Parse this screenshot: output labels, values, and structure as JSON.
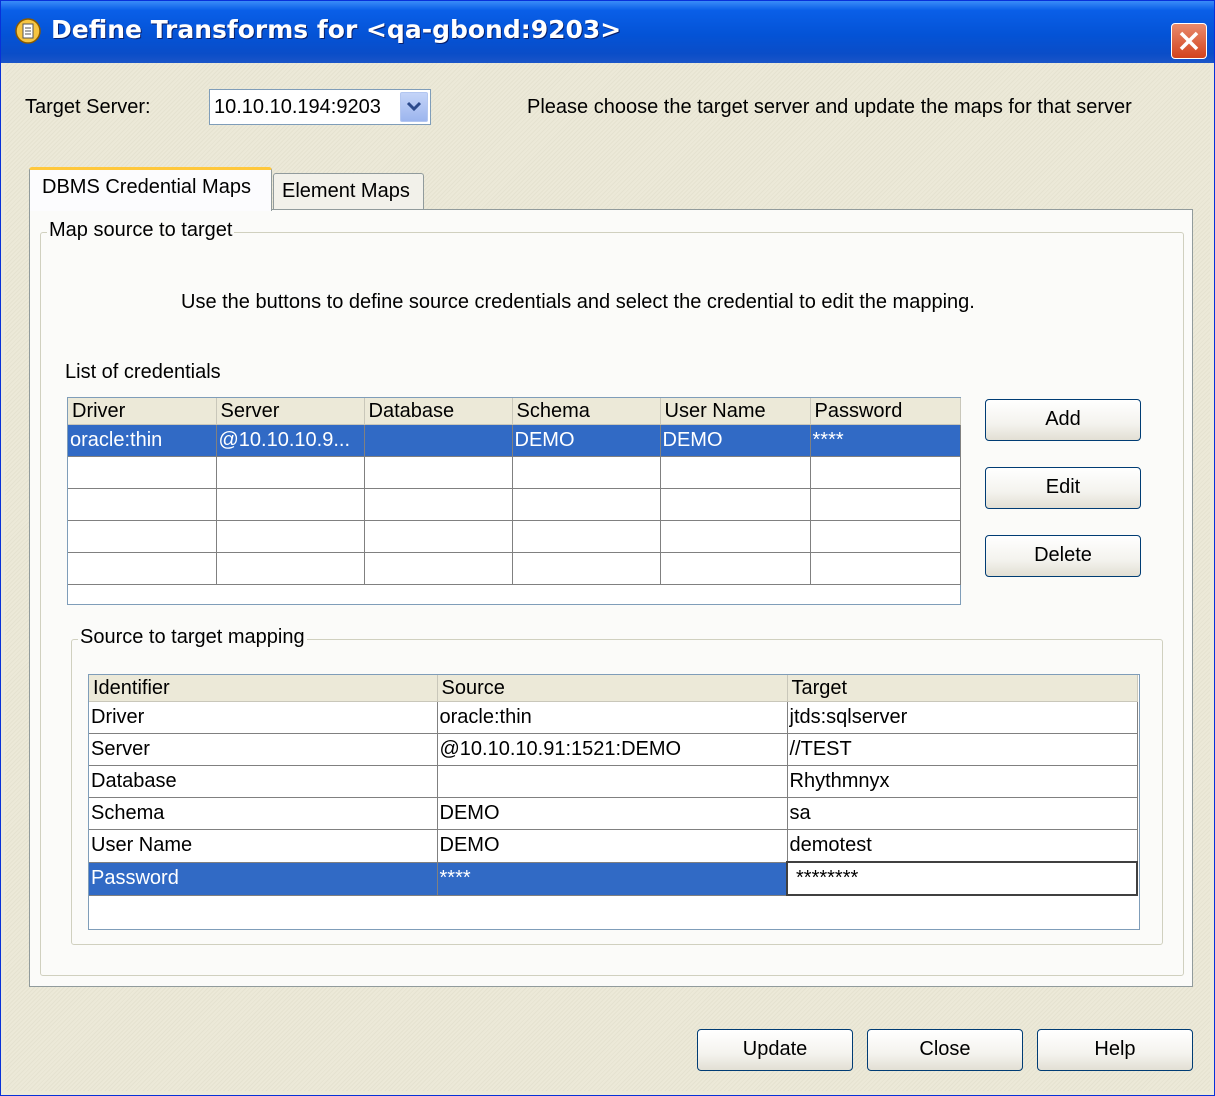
{
  "window": {
    "title": "Define Transforms for <qa-gbond:9203>"
  },
  "target_server": {
    "label": "Target Server:",
    "value": "10.10.10.194:9203",
    "hint": "Please choose the target server and update the maps for that server"
  },
  "tabs": [
    {
      "label": "DBMS Credential Maps",
      "active": true
    },
    {
      "label": "Element Maps",
      "active": false
    }
  ],
  "map_group": {
    "legend": "Map source to target",
    "instructions": "Use the buttons to define source credentials and select the credential to edit the mapping."
  },
  "credentials": {
    "label": "List of credentials",
    "columns": [
      "Driver",
      "Server",
      "Database",
      "Schema",
      "User Name",
      "Password"
    ],
    "rows": [
      [
        "oracle:thin",
        "@10.10.10.9...",
        "",
        "DEMO",
        "DEMO",
        "****"
      ]
    ],
    "buttons": {
      "add": "Add",
      "edit": "Edit",
      "delete": "Delete"
    }
  },
  "mapping": {
    "legend": "Source to target mapping",
    "columns": [
      "Identifier",
      "Source",
      "Target"
    ],
    "rows": [
      [
        "Driver",
        "oracle:thin",
        "jtds:sqlserver"
      ],
      [
        "Server",
        "@10.10.10.91:1521:DEMO",
        "//TEST"
      ],
      [
        "Database",
        "",
        "Rhythmnyx"
      ],
      [
        "Schema",
        "DEMO",
        "sa"
      ],
      [
        "User Name",
        "DEMO",
        "demotest"
      ],
      [
        "Password",
        "****",
        "********"
      ]
    ]
  },
  "footer": {
    "update": "Update",
    "close": "Close",
    "help": "Help"
  },
  "colors": {
    "selection": "#316ac5",
    "titlebar": "#0453d6",
    "tab_accent": "#ffc83c"
  }
}
